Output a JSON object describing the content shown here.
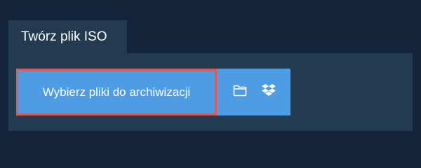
{
  "tab": {
    "label": "Twórz plik ISO"
  },
  "uploader": {
    "select_label": "Wybierz pliki do archiwizacji",
    "icons": [
      "folder-icon",
      "dropbox-icon"
    ]
  },
  "colors": {
    "background": "#13243a",
    "panel": "#243a51",
    "accent": "#4e9ce3",
    "highlight_border": "#db5b5b"
  }
}
